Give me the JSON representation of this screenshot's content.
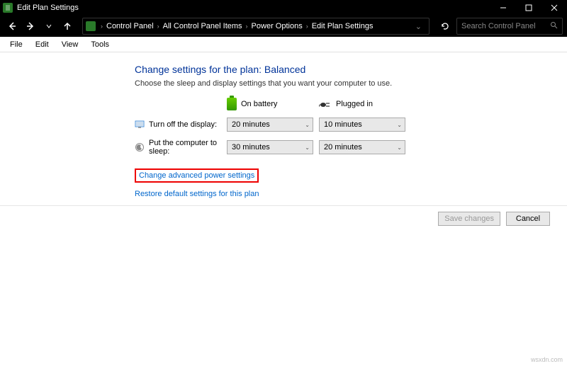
{
  "window": {
    "title": "Edit Plan Settings"
  },
  "breadcrumb": {
    "items": [
      "Control Panel",
      "All Control Panel Items",
      "Power Options",
      "Edit Plan Settings"
    ]
  },
  "search": {
    "placeholder": "Search Control Panel"
  },
  "menu": {
    "items": [
      "File",
      "Edit",
      "View",
      "Tools"
    ]
  },
  "page": {
    "title": "Change settings for the plan: Balanced",
    "description": "Choose the sleep and display settings that you want your computer to use."
  },
  "columns": {
    "battery": "On battery",
    "plugged": "Plugged in"
  },
  "settings": [
    {
      "label": "Turn off the display:",
      "battery_value": "20 minutes",
      "plugged_value": "10 minutes"
    },
    {
      "label": "Put the computer to sleep:",
      "battery_value": "30 minutes",
      "plugged_value": "20 minutes"
    }
  ],
  "links": {
    "advanced": "Change advanced power settings",
    "restore": "Restore default settings for this plan"
  },
  "buttons": {
    "save": "Save changes",
    "cancel": "Cancel"
  },
  "watermark": "wsxdn.com"
}
